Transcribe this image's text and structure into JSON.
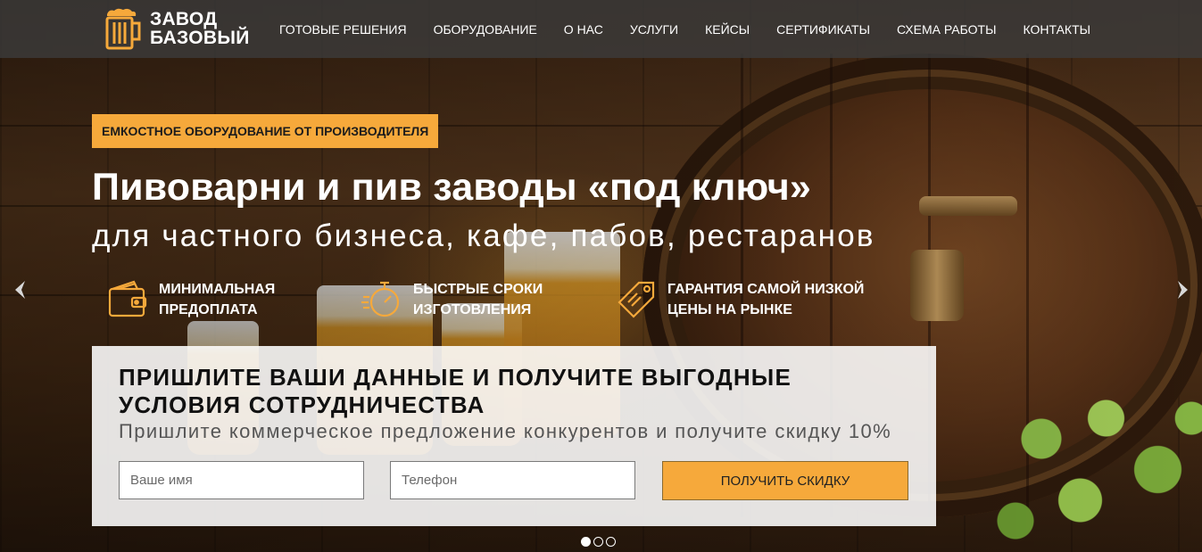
{
  "header": {
    "logo_line1": "ЗАВОД",
    "logo_line2": "БАЗОВЫЙ",
    "nav": [
      "ГОТОВЫЕ РЕШЕНИЯ",
      "ОБОРУДОВАНИЕ",
      "О НАС",
      "УСЛУГИ",
      "КЕЙСЫ",
      "СЕРТИФИКАТЫ",
      "СХЕМА РАБОТЫ",
      "КОНТАКТЫ"
    ]
  },
  "hero": {
    "badge": "ЕМКОСТНОЕ ОБОРУДОВАНИЕ ОТ ПРОИЗВОДИТЕЛЯ",
    "title": "Пивоварни и пив заводы «под ключ»",
    "subtitle": "для частного бизнеса, кафе, пабов, рестаранов",
    "features": [
      {
        "icon": "wallet-icon",
        "line1": "МИНИМАЛЬНАЯ",
        "line2": "ПРЕДОПЛАТА"
      },
      {
        "icon": "stopwatch-icon",
        "line1": "БЫСТРЫЕ СРОКИ",
        "line2": "ИЗГОТОВЛЕНИЯ"
      },
      {
        "icon": "price-tag-icon",
        "line1": "ГАРАНТИЯ САМОЙ НИЗКОЙ",
        "line2": "ЦЕНЫ НА РЫНКЕ"
      }
    ]
  },
  "form": {
    "title": "ПРИШЛИТЕ ВАШИ ДАННЫЕ И ПОЛУЧИТЕ ВЫГОДНЫЕ УСЛОВИЯ СОТРУДНИЧЕСТВА",
    "subtitle": "Пришлите коммерческое предложение конкурентов и получите скидку 10%",
    "name_placeholder": "Ваше имя",
    "phone_placeholder": "Телефон",
    "submit_label": "ПОЛУЧИТЬ СКИДКУ"
  },
  "slider": {
    "slides": 3,
    "active": 1
  },
  "colors": {
    "accent": "#f6a93b",
    "header_bg": "#3c3c3c"
  }
}
